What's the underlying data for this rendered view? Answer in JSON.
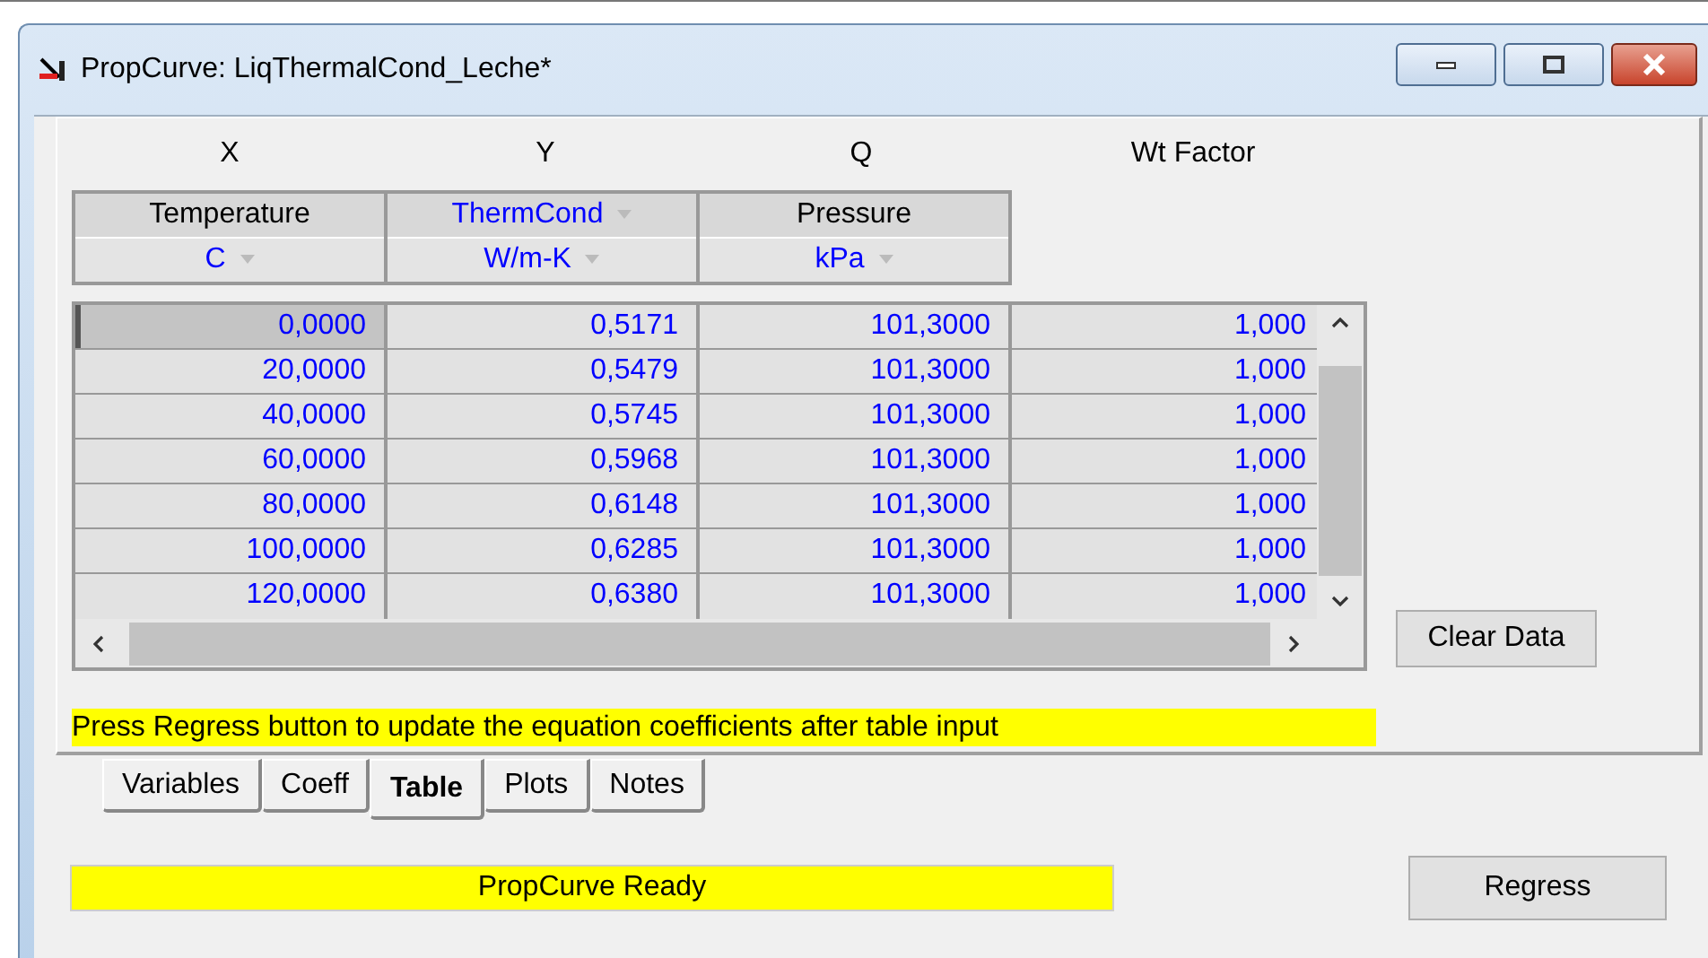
{
  "window": {
    "title": "PropCurve: LiqThermalCond_Leche*"
  },
  "axes": [
    "X",
    "Y",
    "Q",
    "Wt Factor"
  ],
  "header_columns": [
    {
      "name": "Temperature",
      "highlighted": false,
      "unit": "C"
    },
    {
      "name": "ThermCond",
      "highlighted": true,
      "unit": "W/m-K"
    },
    {
      "name": "Pressure",
      "highlighted": false,
      "unit": "kPa"
    }
  ],
  "rows": [
    {
      "selected": true,
      "cells": [
        "0,0000",
        "0,5171",
        "101,3000",
        "1,000"
      ]
    },
    {
      "selected": false,
      "cells": [
        "20,0000",
        "0,5479",
        "101,3000",
        "1,000"
      ]
    },
    {
      "selected": false,
      "cells": [
        "40,0000",
        "0,5745",
        "101,3000",
        "1,000"
      ]
    },
    {
      "selected": false,
      "cells": [
        "60,0000",
        "0,5968",
        "101,3000",
        "1,000"
      ]
    },
    {
      "selected": false,
      "cells": [
        "80,0000",
        "0,6148",
        "101,3000",
        "1,000"
      ]
    },
    {
      "selected": false,
      "cells": [
        "100,0000",
        "0,6285",
        "101,3000",
        "1,000"
      ]
    },
    {
      "selected": false,
      "cells": [
        "120,0000",
        "0,6380",
        "101,3000",
        "1,000"
      ]
    }
  ],
  "clear_button": "Clear Data",
  "message": "Press Regress button to update the equation coefficients after table input",
  "tabs": [
    {
      "label": "Variables",
      "selected": false
    },
    {
      "label": "Coeff",
      "selected": false
    },
    {
      "label": "Table",
      "selected": true
    },
    {
      "label": "Plots",
      "selected": false
    },
    {
      "label": "Notes",
      "selected": false
    }
  ],
  "status": "PropCurve Ready",
  "regress_button": "Regress"
}
